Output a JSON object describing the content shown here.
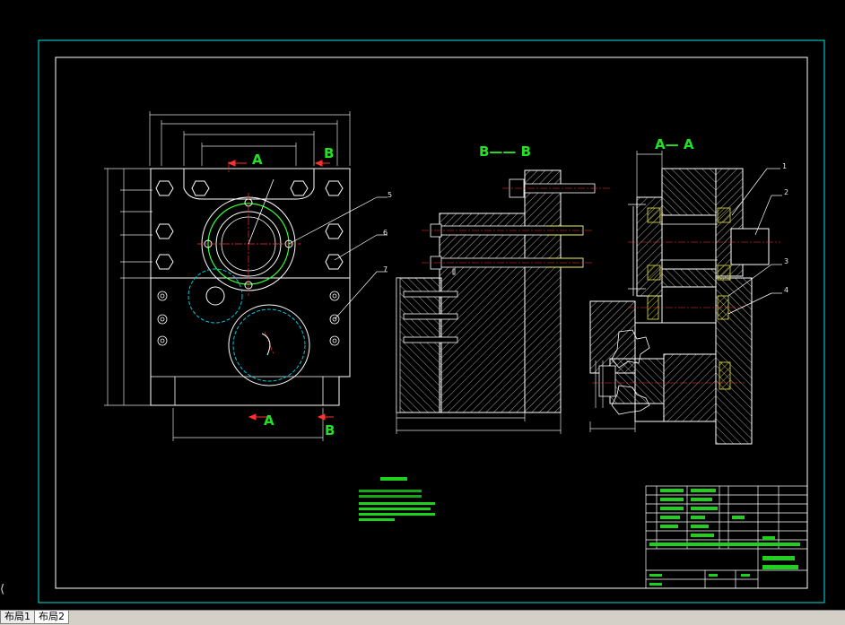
{
  "section_labels": {
    "a_top": "A",
    "b_top": "B",
    "a_bottom": "A",
    "b_bottom": "B",
    "bb_title": "B—— B",
    "aa_title": "A—  A"
  },
  "balloons": [
    "1",
    "2",
    "3",
    "4",
    "5",
    "6",
    "7"
  ],
  "tabs": [
    {
      "label": "布局1"
    },
    {
      "label": "布局2"
    }
  ],
  "colors": {
    "frame": "#00e5e5",
    "geometry": "#ffffff",
    "centerline": "#ff3030",
    "dims": "#e0e0e0",
    "green_text": "#22e022",
    "hatch": "#d8d8d8",
    "hidden": "#00c8e0",
    "bolt": "#ffff40"
  }
}
